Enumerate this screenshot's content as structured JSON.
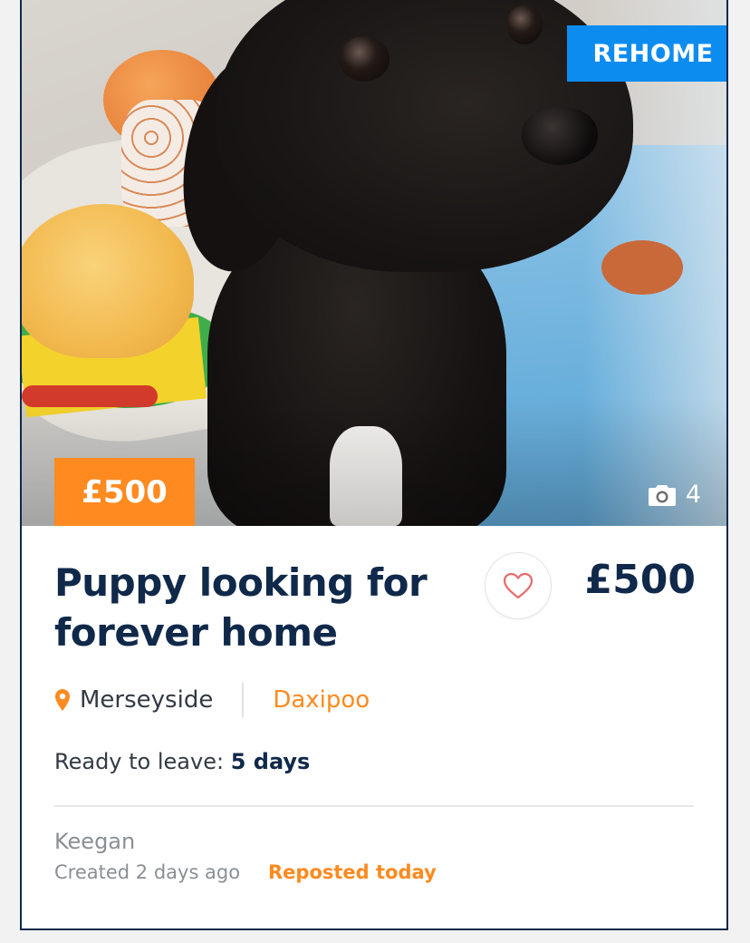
{
  "listing": {
    "badge_label": "REHOME",
    "price_tag": "£500",
    "photo_count": "4",
    "title": "Puppy looking for forever home",
    "price": "£500",
    "location": "Merseyside",
    "breed": "Daxipoo",
    "ready_label": "Ready to leave:",
    "ready_value": "5 days",
    "seller": "Keegan",
    "created": "Created 2 days ago",
    "reposted": "Reposted today",
    "favorited": false
  },
  "icons": {
    "camera": "camera-icon",
    "heart": "heart-outline-icon",
    "pin": "location-pin-icon"
  },
  "colors": {
    "navy": "#10294a",
    "orange": "#ff8a1f",
    "blue": "#0d8cf0",
    "heart": "#e86a6a"
  }
}
